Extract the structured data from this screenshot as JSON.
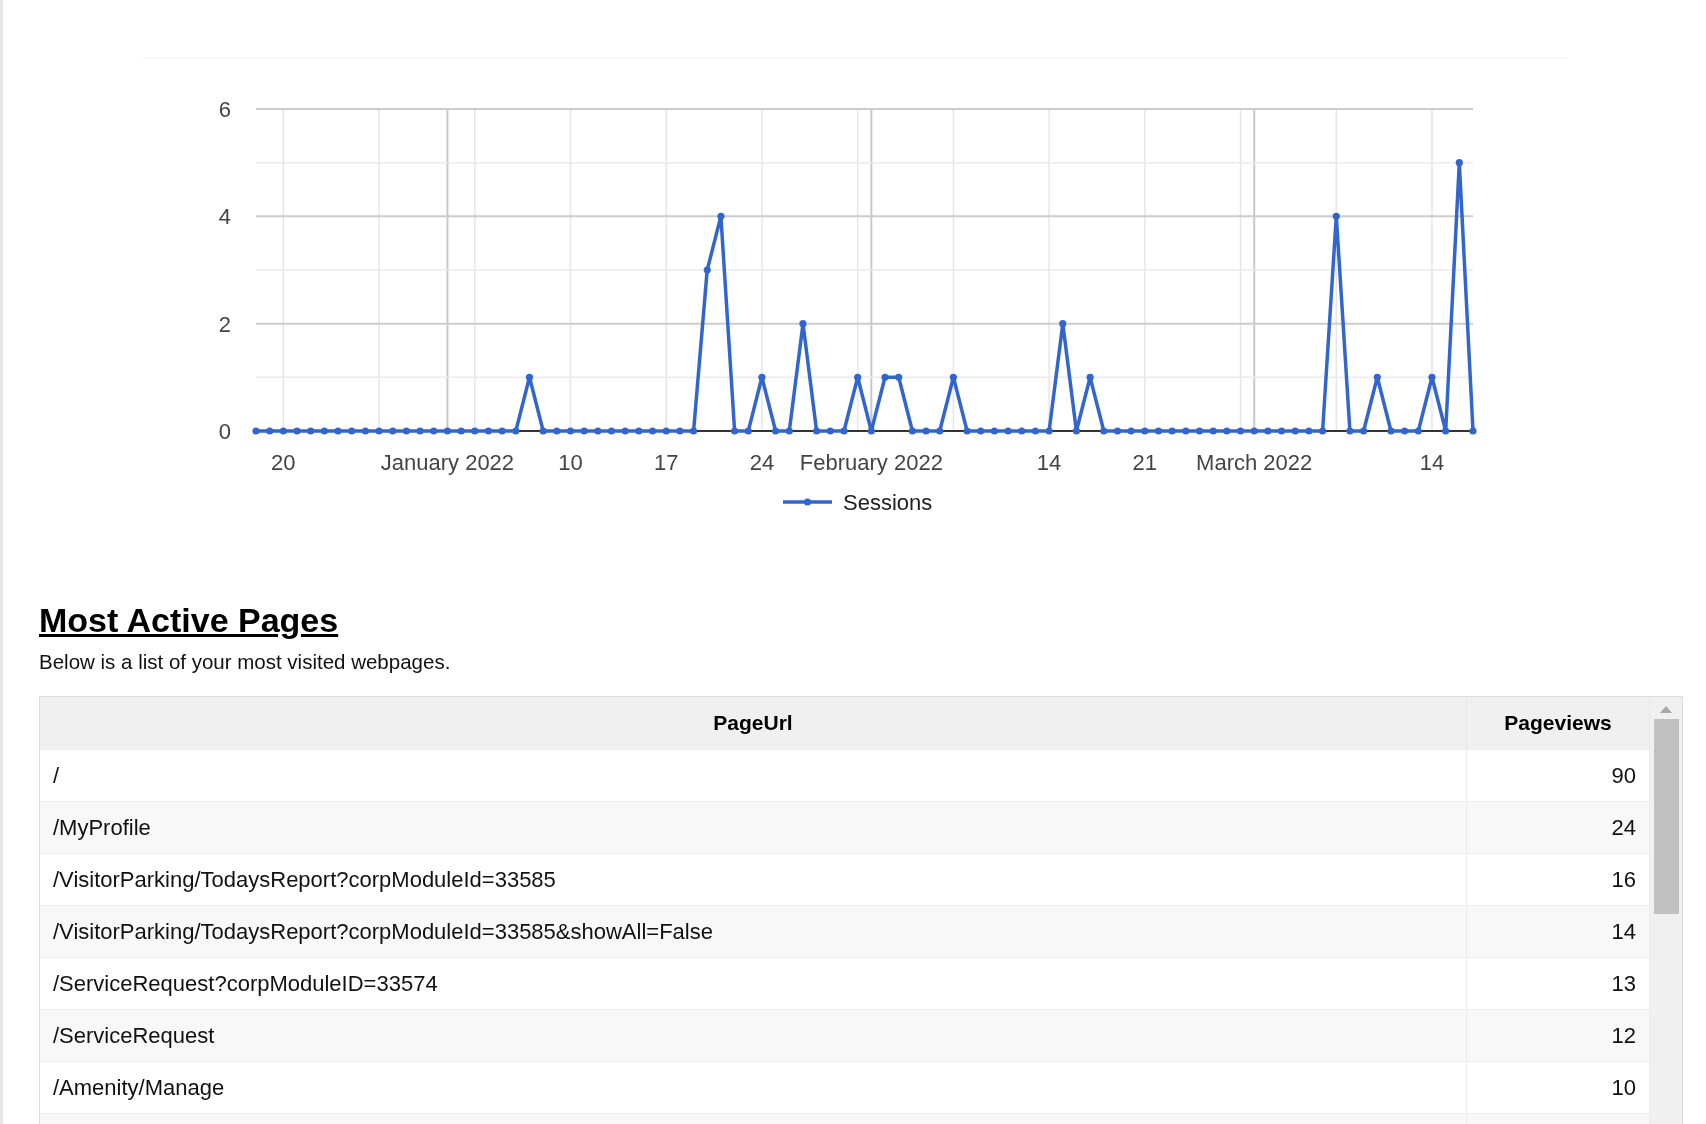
{
  "chart": {
    "chart_data": {
      "type": "line",
      "grid": true,
      "categories": [
        null,
        null,
        "20",
        null,
        null,
        null,
        null,
        null,
        null,
        null,
        null,
        null,
        null,
        null,
        "January 2022",
        null,
        null,
        null,
        null,
        null,
        null,
        null,
        null,
        "10",
        null,
        null,
        null,
        null,
        null,
        null,
        "17",
        null,
        null,
        null,
        null,
        null,
        null,
        "24",
        null,
        null,
        null,
        null,
        null,
        null,
        null,
        "February 2022",
        null,
        null,
        null,
        null,
        null,
        null,
        null,
        null,
        null,
        null,
        null,
        null,
        "14",
        null,
        null,
        null,
        null,
        null,
        null,
        "21",
        null,
        null,
        null,
        null,
        null,
        null,
        null,
        "March 2022",
        null,
        null,
        null,
        null,
        null,
        null,
        null,
        null,
        null,
        null,
        null,
        null,
        "14",
        null,
        null,
        null
      ],
      "series": [
        {
          "name": "Sessions",
          "color": "#3366cc",
          "marker": true,
          "values": [
            0,
            0,
            0,
            0,
            0,
            0,
            0,
            0,
            0,
            0,
            0,
            0,
            0,
            0,
            0,
            0,
            0,
            0,
            0,
            0,
            1,
            0,
            0,
            0,
            0,
            0,
            0,
            0,
            0,
            0,
            0,
            0,
            0,
            3,
            4,
            0,
            0,
            1,
            0,
            0,
            2,
            0,
            0,
            0,
            1,
            0,
            1,
            1,
            0,
            0,
            0,
            1,
            0,
            0,
            0,
            0,
            0,
            0,
            0,
            2,
            0,
            1,
            0,
            0,
            0,
            0,
            0,
            0,
            0,
            0,
            0,
            0,
            0,
            0,
            0,
            0,
            0,
            0,
            0,
            4,
            0,
            0,
            1,
            0,
            0,
            0,
            1,
            0,
            5,
            0
          ]
        }
      ],
      "ylim": [
        0,
        6
      ],
      "yticks": [
        0,
        2,
        4,
        6
      ]
    }
  },
  "section": {
    "title": "Most Active Pages",
    "description": "Below is a list of your most visited webpages."
  },
  "table": {
    "columns": [
      "PageUrl",
      "Pageviews"
    ],
    "rows": [
      [
        "/",
        "90"
      ],
      [
        "/MyProfile",
        "24"
      ],
      [
        "/VisitorParking/TodaysReport?corpModuleId=33585",
        "16"
      ],
      [
        "/VisitorParking/TodaysReport?corpModuleId=33585&showAll=False",
        "14"
      ],
      [
        "/ServiceRequest?corpModuleID=33574",
        "13"
      ],
      [
        "/ServiceRequest",
        "12"
      ],
      [
        "/Amenity/Manage",
        "10"
      ]
    ]
  }
}
